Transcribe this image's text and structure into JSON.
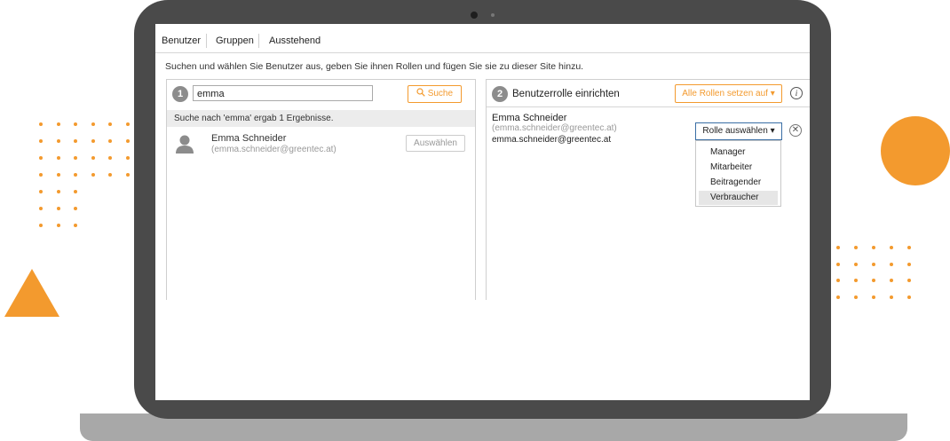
{
  "colors": {
    "accent": "#f39a2e",
    "laptop_frame": "#4a4a4a",
    "laptop_base": "#a8a8a8",
    "select_border": "#3a6ea5"
  },
  "tabs": [
    "Benutzer",
    "Gruppen",
    "Ausstehend"
  ],
  "instruction": "Suchen und wählen Sie Benutzer aus, geben Sie ihnen Rollen und fügen Sie sie zu dieser Site hinzu.",
  "left_panel": {
    "step": "1",
    "search_value": "emma",
    "search_button": "Suche",
    "search_icon": "magnifier-icon",
    "result_text": "Suche nach 'emma' ergab 1 Ergebnisse.",
    "result": {
      "name": "Emma Schneider",
      "email": "(emma.schneider@greentec.at)",
      "select_button": "Auswählen",
      "avatar_icon": "user-silhouette-icon"
    }
  },
  "right_panel": {
    "step": "2",
    "title": "Benutzerrolle einrichten",
    "set_all_button": "Alle Rollen setzen auf ▾",
    "info_icon": "info-icon",
    "user": {
      "name": "Emma Schneider",
      "email_paren": "(emma.schneider@greentec.at)",
      "email": "emma.schneider@greentec.at"
    },
    "role_select": "Rolle auswählen ▾",
    "remove_icon": "close-circle-icon",
    "role_options": [
      "Manager",
      "Mitarbeiter",
      "Beitragender",
      "Verbraucher"
    ],
    "highlighted_option": "Verbraucher"
  }
}
